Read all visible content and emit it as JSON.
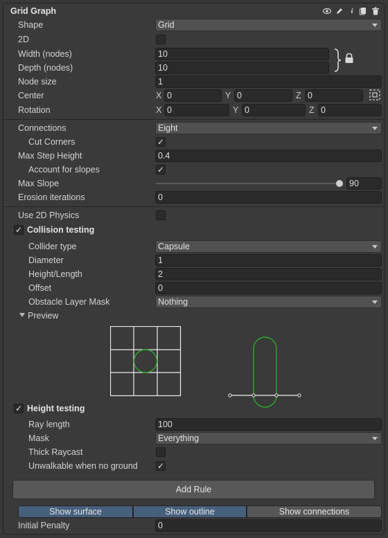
{
  "header": {
    "title": "Grid Graph"
  },
  "icons": [
    "eye-icon",
    "pencil-icon",
    "info-icon",
    "copy-icon",
    "trash-icon",
    "lock-icon",
    "link-brace-icon",
    "center-gizmo-icon"
  ],
  "rows": {
    "shape": {
      "label": "Shape",
      "value": "Grid"
    },
    "is2d": {
      "label": "2D",
      "checked": false
    },
    "width": {
      "label": "Width (nodes)",
      "value": "10"
    },
    "depth": {
      "label": "Depth (nodes)",
      "value": "10"
    },
    "node_size": {
      "label": "Node size",
      "value": "1"
    },
    "center": {
      "label": "Center",
      "x_label": "X",
      "x": "0",
      "y_label": "Y",
      "y": "0",
      "z_label": "Z",
      "z": "0"
    },
    "rotation": {
      "label": "Rotation",
      "x_label": "X",
      "x": "0",
      "y_label": "Y",
      "y": "0",
      "z_label": "Z",
      "z": "0"
    },
    "connections": {
      "label": "Connections",
      "value": "Eight"
    },
    "cut_corners": {
      "label": "Cut Corners",
      "checked": true
    },
    "max_step_height": {
      "label": "Max Step Height",
      "value": "0.4"
    },
    "account_slopes": {
      "label": "Account for slopes",
      "checked": true
    },
    "max_slope": {
      "label": "Max Slope",
      "value": "90",
      "slider_fraction": 1.0
    },
    "erosion": {
      "label": "Erosion iterations",
      "value": "0"
    },
    "use_2d_physics": {
      "label": "Use 2D Physics",
      "checked": false
    },
    "collision_testing": {
      "label": "Collision testing",
      "checked": true
    },
    "collider_type": {
      "label": "Collider type",
      "value": "Capsule"
    },
    "diameter": {
      "label": "Diameter",
      "value": "1"
    },
    "height_length": {
      "label": "Height/Length",
      "value": "2"
    },
    "offset": {
      "label": "Offset",
      "value": "0"
    },
    "obstacle_mask": {
      "label": "Obstacle Layer Mask",
      "value": "Nothing"
    },
    "preview": {
      "label": "Preview"
    },
    "height_testing": {
      "label": "Height testing",
      "checked": true
    },
    "ray_length": {
      "label": "Ray length",
      "value": "100"
    },
    "mask": {
      "label": "Mask",
      "value": "Everything"
    },
    "thick_raycast": {
      "label": "Thick Raycast",
      "checked": false
    },
    "unwalkable": {
      "label": "Unwalkable when no ground",
      "checked": true
    },
    "add_rule": {
      "label": "Add Rule"
    },
    "show": {
      "surface": "Show surface",
      "outline": "Show outline",
      "connections": "Show connections"
    },
    "initial_penalty": {
      "label": "Initial Penalty",
      "value": "0"
    }
  },
  "colors": {
    "accent_green": "#2ea82e",
    "toggle_on": "#46607c",
    "toggle_off": "#575757"
  }
}
